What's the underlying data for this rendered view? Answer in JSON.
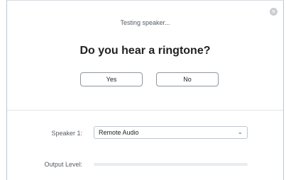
{
  "dialog": {
    "close_icon": "close-icon",
    "status": "Testing speaker...",
    "question": "Do you hear a ringtone?",
    "yes_label": "Yes",
    "no_label": "No"
  },
  "speaker": {
    "label": "Speaker 1:",
    "selected": "Remote Audio",
    "chevron_icon": "chevron-down-icon"
  },
  "output": {
    "label": "Output Level:",
    "level": 0
  },
  "colors": {
    "accent": "#2d8cff",
    "border": "#b9c6d6"
  }
}
